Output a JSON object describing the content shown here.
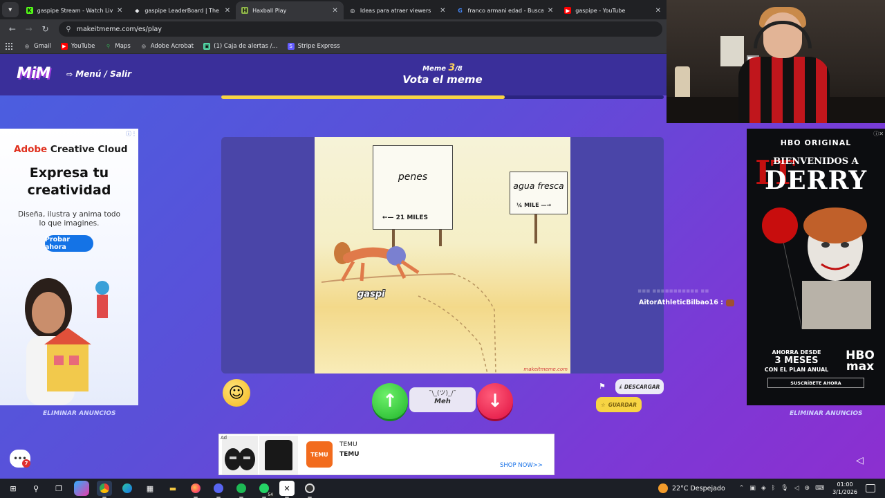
{
  "browser": {
    "tabs": [
      {
        "title": "gaspipe Stream - Watch Live on",
        "favicon": "K",
        "fav_color": "#53fc18",
        "active": false
      },
      {
        "title": "gaspipe LeaderBoard | The best",
        "favicon": "◆",
        "fav_color": "#e8eaed",
        "active": false
      },
      {
        "title": "Haxball Play",
        "favicon": "H",
        "fav_color": "#8fb54a",
        "active": true
      },
      {
        "title": "Ideas para atraer viewers",
        "favicon": "◎",
        "fav_color": "#e8eaed",
        "active": false
      },
      {
        "title": "franco armani edad - Buscar con",
        "favicon": "G",
        "fav_color": "#4285f4",
        "active": false
      },
      {
        "title": "gaspipe - YouTube",
        "favicon": "▶",
        "fav_color": "#ff0000",
        "active": false
      }
    ],
    "url": "makeitmeme.com/es/play",
    "bookmarks": [
      {
        "label": "Gmail",
        "icon": "globe-icon",
        "color": "#e8eaed"
      },
      {
        "label": "YouTube",
        "icon": "youtube-icon",
        "color": "#ff0000"
      },
      {
        "label": "Maps",
        "icon": "maps-icon",
        "color": "#34a853"
      },
      {
        "label": "Adobe Acrobat",
        "icon": "globe-icon",
        "color": "#e8eaed"
      },
      {
        "label": "(1) Caja de alertas /...",
        "icon": "alerts-icon",
        "color": "#53d6a6"
      },
      {
        "label": "Stripe Express",
        "icon": "stripe-icon",
        "color": "#635bff"
      }
    ]
  },
  "game": {
    "logo": "MiM",
    "menu_label": "Menú / Salir",
    "meme_prefix": "Meme",
    "meme_current": "3",
    "meme_total": "/8",
    "vote_title": "Vota el meme",
    "progress": 0.64,
    "meme_caption": "gaspi",
    "sign_left": "penes",
    "sign_left_miles": "←— 21 MILES",
    "sign_right": "agua fresca",
    "sign_right_mile": "¼ MILE —→",
    "watermark": "makeitmeme.com",
    "chat_user": "AitorAthleticBilbao16 :",
    "meh_shrug": "¯\\_(ツ)_/¯",
    "meh_label": "Meh",
    "descargar": "DESCARGAR",
    "guardar": "GUARDAR",
    "remove_ads_left": "ELIMINAR ANUNCIOS",
    "remove_ads_right": "ELIMINAR ANUNCIOS",
    "chat_badge": "7"
  },
  "ad_left": {
    "brand_red": "Adobe",
    "brand": " Creative Cloud",
    "headline": "Expresa tu creatividad",
    "sub": "Diseña, ilustra y anima todo lo que imagines.",
    "cta": "Probar ahora"
  },
  "ad_right": {
    "hbo": "HBO ORIGINAL",
    "it": "IT",
    "bienvenidos": "BIENVENIDOS A",
    "derry": "DERRY",
    "ahorra_top": "AHORRA DESDE",
    "ahorra_big": "3 MESES",
    "ahorra_bottom": "CON EL PLAN ANUAL",
    "hbomax": "HBO max",
    "suscribete": "SUSCRÍBETE AHORA"
  },
  "ad_bottom": {
    "label": "Ad",
    "brand_logo": "TEMU",
    "line1": "TEMU",
    "line2": "TEMU",
    "cta": "SHOP NOW>>"
  },
  "taskbar": {
    "weather": "22°C  Despejado",
    "time": "01:00",
    "date": "3/1/2026",
    "whatsapp_badge": "54"
  }
}
